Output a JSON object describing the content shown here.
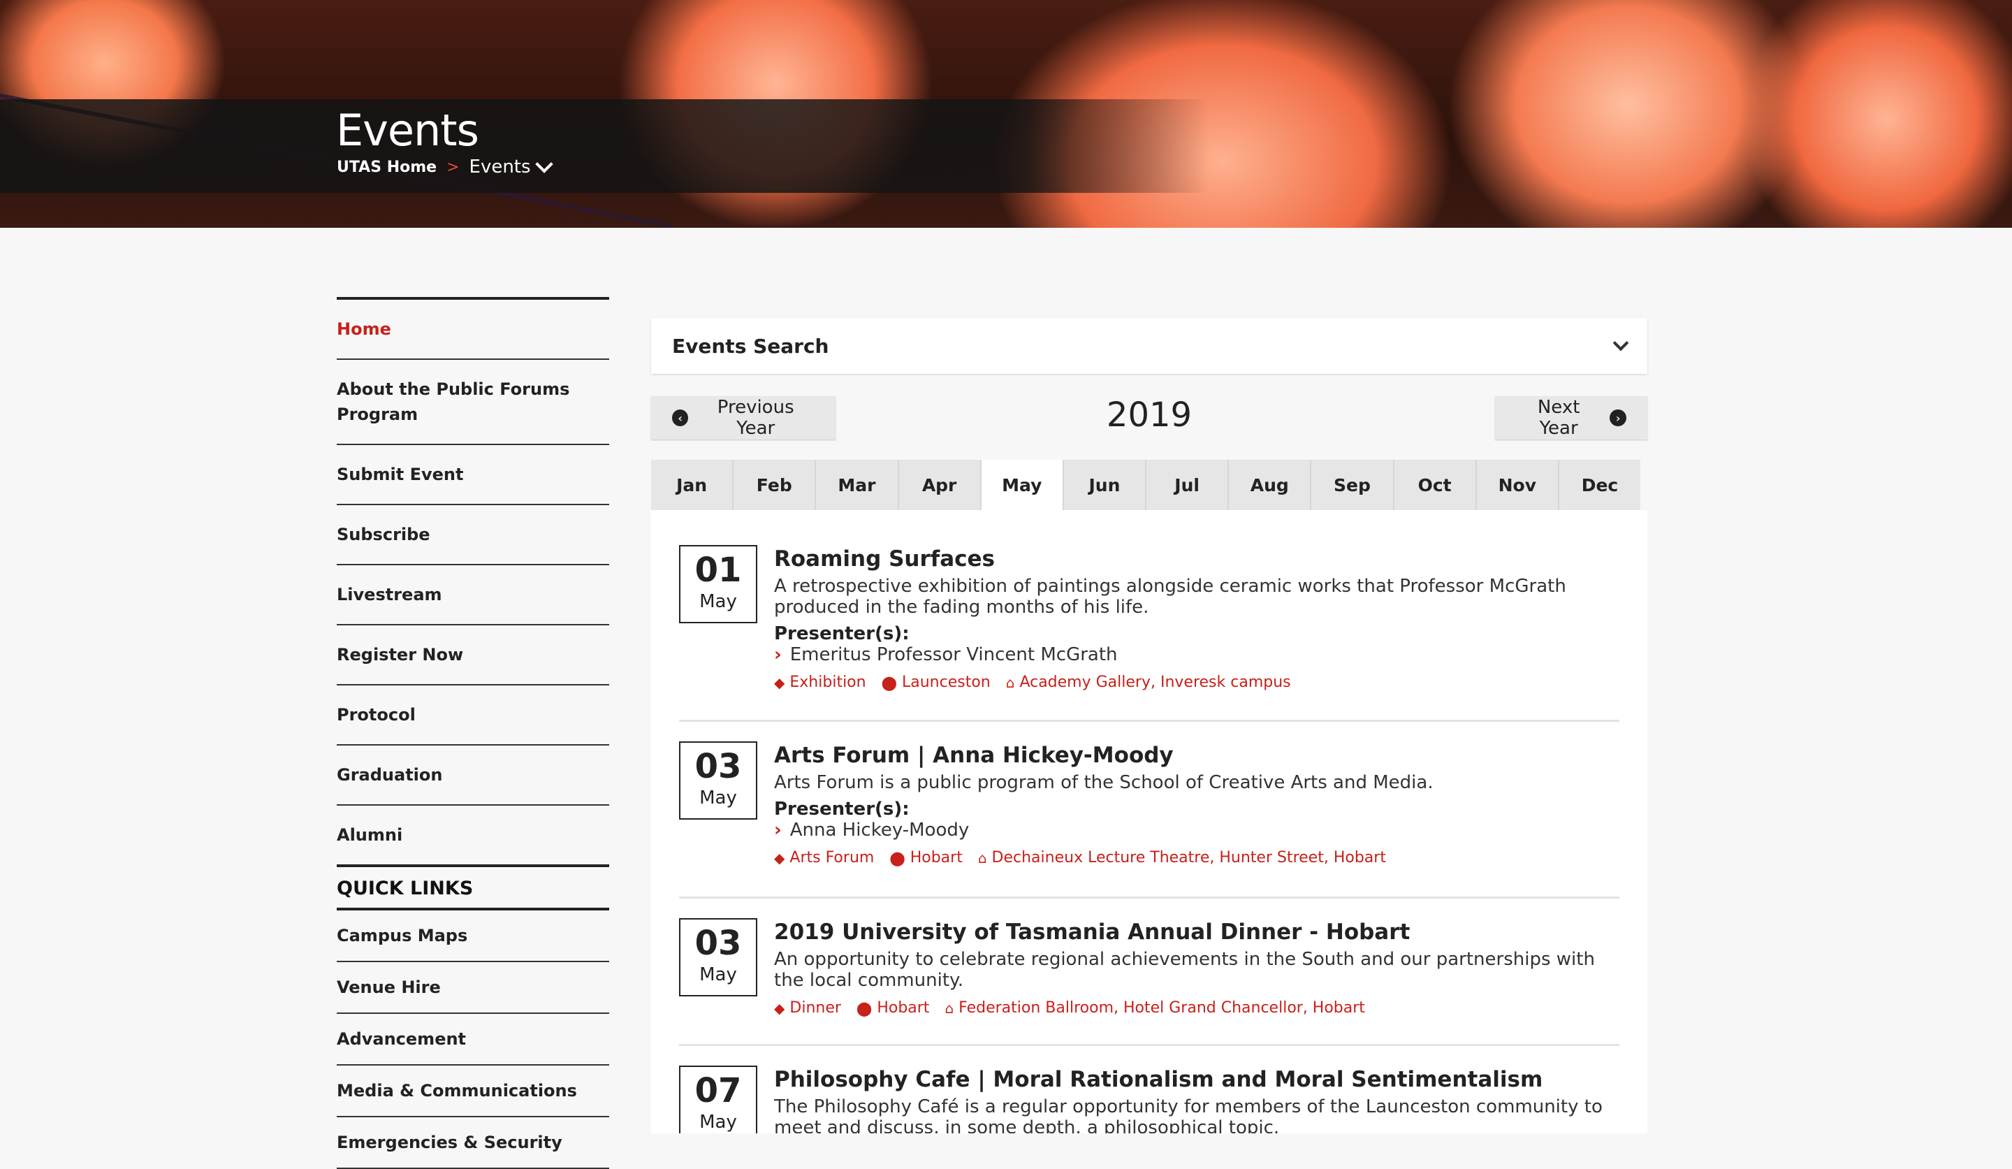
{
  "header": {
    "title": "Events",
    "breadcrumb": {
      "home": "UTAS Home",
      "separator": ">",
      "current": "Events"
    }
  },
  "sidenav": {
    "items": [
      {
        "label": "Home",
        "active": true
      },
      {
        "label": "About the Public Forums Program"
      },
      {
        "label": "Submit Event"
      },
      {
        "label": "Subscribe"
      },
      {
        "label": "Livestream"
      },
      {
        "label": "Register Now"
      },
      {
        "label": "Protocol"
      },
      {
        "label": "Graduation"
      },
      {
        "label": "Alumni"
      }
    ]
  },
  "quick_links": {
    "title": "QUICK LINKS",
    "items": [
      {
        "label": "Campus Maps"
      },
      {
        "label": "Venue Hire"
      },
      {
        "label": "Advancement"
      },
      {
        "label": "Media & Communications"
      },
      {
        "label": "Emergencies & Security"
      }
    ]
  },
  "search": {
    "label": "Events Search"
  },
  "year_nav": {
    "prev_label": "Previous Year",
    "next_label": "Next Year",
    "year": "2019"
  },
  "months": [
    {
      "label": "Jan"
    },
    {
      "label": "Feb"
    },
    {
      "label": "Mar"
    },
    {
      "label": "Apr"
    },
    {
      "label": "May",
      "active": true
    },
    {
      "label": "Jun"
    },
    {
      "label": "Jul"
    },
    {
      "label": "Aug"
    },
    {
      "label": "Sep"
    },
    {
      "label": "Oct"
    },
    {
      "label": "Nov"
    },
    {
      "label": "Dec"
    }
  ],
  "events": [
    {
      "day": "01",
      "month": "May",
      "title": "Roaming Surfaces",
      "description": "A retrospective exhibition of paintings alongside ceramic works that Professor McGrath produced in the fading months of his life.",
      "presenter_label": "Presenter(s):",
      "presenter": "Emeritus Professor Vincent McGrath",
      "category": "Exhibition",
      "location": "Launceston",
      "venue": "Academy Gallery, Inveresk campus"
    },
    {
      "day": "03",
      "month": "May",
      "title": "Arts Forum | Anna Hickey-Moody",
      "description": "Arts Forum is a public program of the School of Creative Arts and Media.",
      "presenter_label": "Presenter(s):",
      "presenter": "Anna Hickey-Moody",
      "category": "Arts Forum",
      "location": "Hobart",
      "venue": "Dechaineux Lecture Theatre, Hunter Street, Hobart"
    },
    {
      "day": "03",
      "month": "May",
      "title": "2019 University of Tasmania Annual Dinner - Hobart",
      "description": "An opportunity to celebrate regional achievements in the South and our partnerships with the local community.",
      "category": "Dinner",
      "location": "Hobart",
      "venue": "Federation Ballroom, Hotel Grand Chancellor, Hobart"
    },
    {
      "day": "07",
      "month": "May",
      "title": "Philosophy Cafe | Moral Rationalism and Moral Sentimentalism",
      "description": "The Philosophy Café is a regular opportunity for members of the Launceston community to meet and discuss, in some depth, a philosophical topic."
    }
  ],
  "icons": {
    "tag": "tag-icon",
    "location": "map-marker-icon",
    "venue": "home-icon",
    "presenter": "chevron-right-icon",
    "prev": "circle-arrow-left-icon",
    "next": "circle-arrow-right-icon"
  },
  "colors": {
    "accent": "#c8201a",
    "text": "#222222",
    "page_bg": "#f7f7f7"
  }
}
